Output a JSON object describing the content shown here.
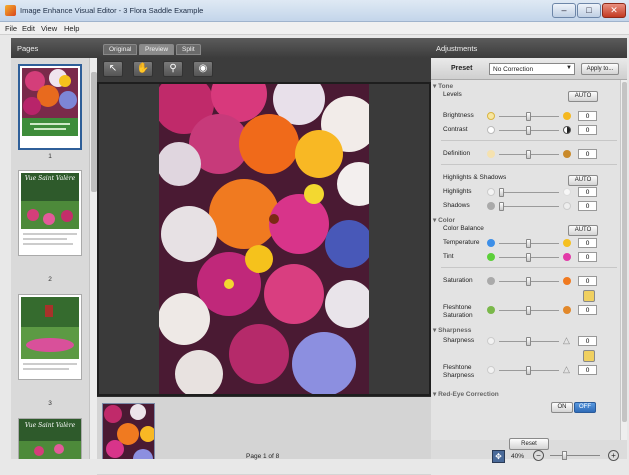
{
  "window": {
    "title": "Image Enhance Visual Editor - 3 Flora Saddle Example"
  },
  "menu": [
    "File",
    "Edit",
    "View",
    "Help"
  ],
  "pages": {
    "header": "Pages",
    "items": [
      {
        "number": "1",
        "caption": "",
        "selected": true
      },
      {
        "number": "2",
        "caption": "Vue Saint Valère",
        "selected": false
      },
      {
        "number": "3",
        "caption": "",
        "selected": false
      },
      {
        "number": "",
        "caption": "Vue Saint Valère",
        "selected": false
      }
    ]
  },
  "view_tabs": [
    "Original",
    "Preview",
    "Split"
  ],
  "tools": [
    {
      "icon": "pointer-icon",
      "glyph": "↖"
    },
    {
      "icon": "hand-icon",
      "glyph": "✋"
    },
    {
      "icon": "zoom-icon",
      "glyph": "⚲"
    },
    {
      "icon": "eye-icon",
      "glyph": "◉"
    }
  ],
  "adjustments": {
    "header": "Adjustments",
    "preset_label": "Preset",
    "preset_value": "No Correction",
    "apply_button": "Apply to...",
    "tone": {
      "section": "Tone",
      "levels_label": "Levels",
      "auto": "AUTO",
      "brightness": {
        "label": "Brightness",
        "value": "0"
      },
      "contrast": {
        "label": "Contrast",
        "value": "0"
      },
      "definition": {
        "label": "Definition",
        "value": "0"
      },
      "hs_label": "Highlights & Shadows",
      "hs_auto": "AUTO",
      "highlights": {
        "label": "Highlights",
        "value": "0"
      },
      "shadows": {
        "label": "Shadows",
        "value": "0"
      }
    },
    "color": {
      "section": "Color",
      "balance_label": "Color Balance",
      "auto": "AUTO",
      "temperature": {
        "label": "Temperature",
        "value": "0"
      },
      "tint": {
        "label": "Tint",
        "value": "0"
      },
      "saturation": {
        "label": "Saturation",
        "value": "0"
      },
      "fleshtone_saturation": {
        "label1": "Fleshtone",
        "label2": "Saturation",
        "value": "0"
      }
    },
    "sharpness": {
      "section": "Sharpness",
      "sharpness": {
        "label": "Sharpness",
        "value": "0"
      },
      "fleshtone_sharpness": {
        "label1": "Fleshtone",
        "label2": "Sharpness",
        "value": "0"
      }
    },
    "redeye": {
      "section": "Red-Eye Correction",
      "on": "ON",
      "off": "OFF"
    },
    "reset": "Reset"
  },
  "status": {
    "page": "Page 1 of 8",
    "zoom": "40%"
  },
  "colors": {
    "accent": "#2f5f99",
    "panel_dark": "#3c3c3c"
  }
}
